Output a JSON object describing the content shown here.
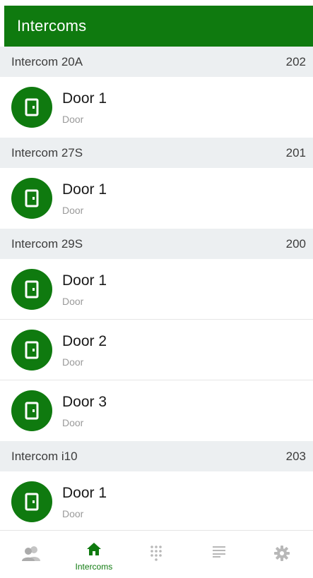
{
  "app_bar": {
    "title": "Intercoms"
  },
  "groups": [
    {
      "name": "Intercom 20A",
      "number": "202",
      "doors": [
        {
          "name": "Door 1",
          "type": "Door"
        }
      ]
    },
    {
      "name": "Intercom 27S",
      "number": "201",
      "doors": [
        {
          "name": "Door 1",
          "type": "Door"
        }
      ]
    },
    {
      "name": "Intercom 29S",
      "number": "200",
      "doors": [
        {
          "name": "Door 1",
          "type": "Door"
        },
        {
          "name": "Door 2",
          "type": "Door"
        },
        {
          "name": "Door 3",
          "type": "Door"
        }
      ]
    },
    {
      "name": "Intercom i10",
      "number": "203",
      "doors": [
        {
          "name": "Door 1",
          "type": "Door"
        }
      ]
    }
  ],
  "bottom_nav": [
    {
      "id": "contacts",
      "icon": "contacts-icon",
      "label": "",
      "active": false
    },
    {
      "id": "intercoms",
      "icon": "home-icon",
      "label": "Intercoms",
      "active": true
    },
    {
      "id": "keypad",
      "icon": "dialpad-icon",
      "label": "",
      "active": false
    },
    {
      "id": "log",
      "icon": "list-icon",
      "label": "",
      "active": false
    },
    {
      "id": "settings",
      "icon": "gear-icon",
      "label": "",
      "active": false
    }
  ],
  "colors": {
    "primary": "#0f7a0f",
    "header_bg": "#eceff1",
    "icon_inactive": "#b8b8b8"
  }
}
